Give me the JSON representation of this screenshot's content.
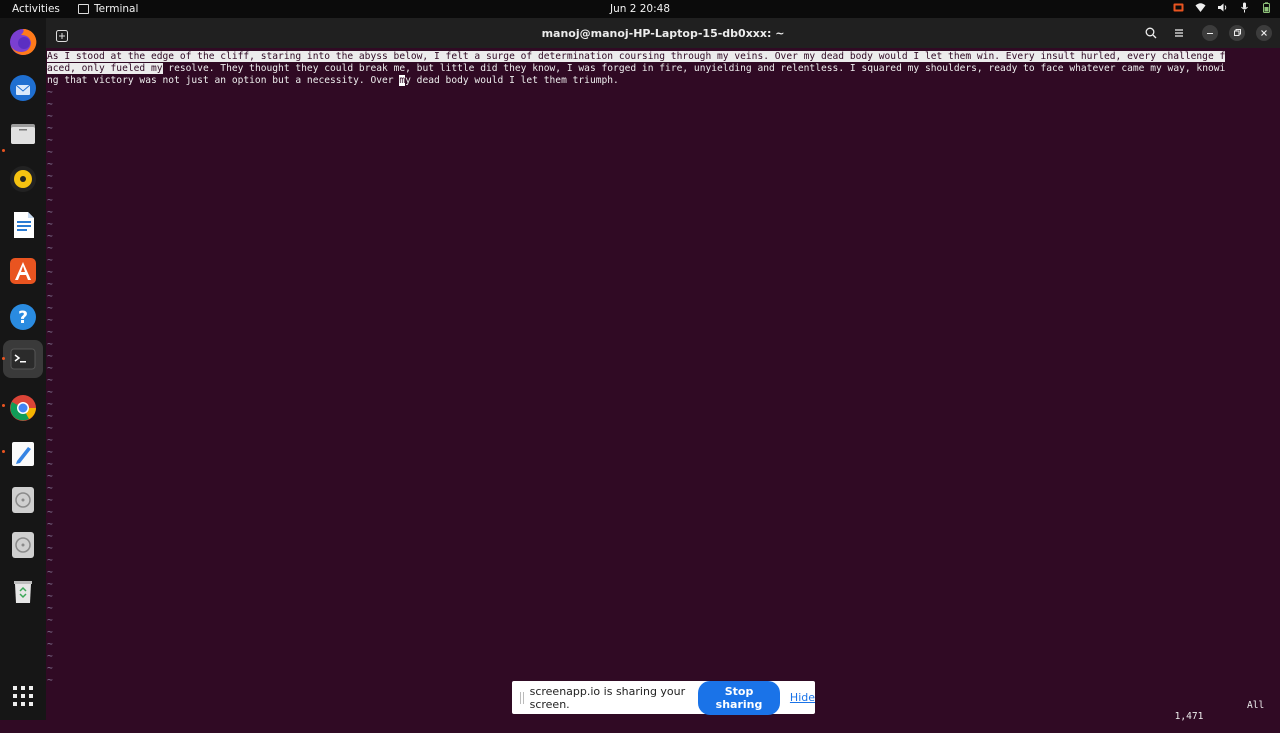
{
  "topbar": {
    "activities": "Activities",
    "app_name": "Terminal",
    "clock": "Jun 2  20:48"
  },
  "window": {
    "title": "manoj@manoj-HP-Laptop-15-db0xxx: ~"
  },
  "dock": {
    "items": [
      "firefox-icon",
      "thunderbird-icon",
      "files-icon",
      "rhythmbox-icon",
      "writer-icon",
      "app-center-icon",
      "help-icon",
      "terminal-icon",
      "chrome-icon",
      "text-editor-icon",
      "disc-icon",
      "disc-icon",
      "trash-icon",
      "app-grid-icon"
    ]
  },
  "editor": {
    "line1_sel": "As I stood at the edge of the cliff, staring into the abyss below, I felt a surge of determination coursing through my veins. Over my dead body would I let them win. Every insult hurled, every challenge f",
    "line2_sel": "aced, only fueled my",
    "line2_rest": " resolve. They thought they could break me, but little did they know, I was forged in fire, unyielding and relentless. I squared my shoulders, ready to face whatever came my way, knowi",
    "line3_a": "ng that victory was not just an option but a necessity. Over ",
    "line3_cursor": "m",
    "line3_b": "y dead body would I let them triumph.",
    "position": "1,471",
    "scroll": "All"
  },
  "share_banner": {
    "message": "screenapp.io is sharing your screen.",
    "stop_label": "Stop sharing",
    "hide_label": "Hide"
  },
  "colors": {
    "terminal_bg": "#300a24",
    "accent": "#e95420",
    "link": "#1a73e8"
  }
}
